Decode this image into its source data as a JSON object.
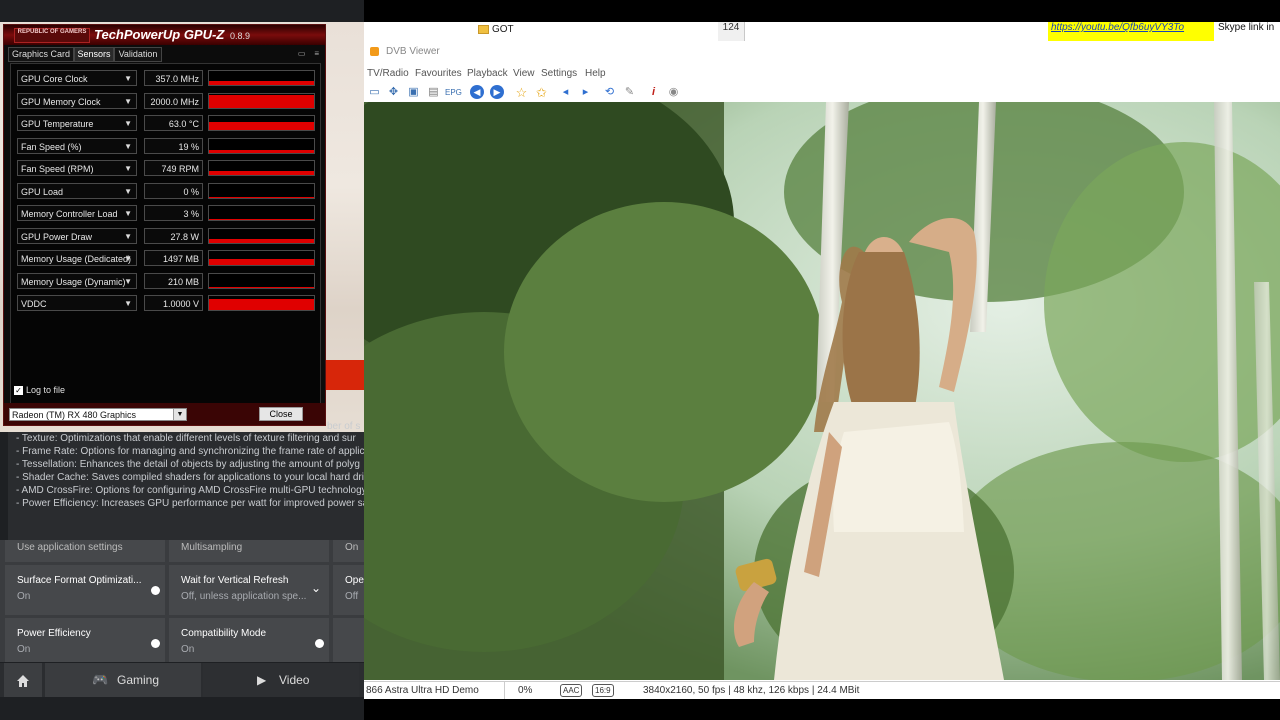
{
  "spreadsheet": {
    "folder_name": "GOT",
    "row_number": "124",
    "link": "https://youtu.be/Qfb6uyVY3To",
    "note": "Skype link in"
  },
  "radeon": {
    "description_lines": [
      "- Texture: Optimizations that enable different levels of texture filtering and sur",
      "- Frame Rate: Options for managing and synchronizing the frame rate of applic",
      "- Tessellation: Enhances the detail of objects by adjusting the amount of polyg",
      "- Shader Cache: Saves compiled shaders for applications to your local hard driv",
      "- AMD CrossFire: Options for configuring AMD CrossFire multi-GPU technology.",
      "- Power Efficiency: Increases GPU performance per watt for improved power sa"
    ],
    "partial_text": "ber of s",
    "tiles": [
      {
        "title": "Use application settings",
        "sub": ""
      },
      {
        "title": "Multisampling",
        "sub": ""
      },
      {
        "title": "On",
        "sub": ""
      },
      {
        "title": "Surface Format Optimizati...",
        "sub": "On"
      },
      {
        "title": "Wait for Vertical Refresh",
        "sub": "Off, unless application spe..."
      },
      {
        "title": "Ope",
        "sub": "Off"
      },
      {
        "title": "Power Efficiency",
        "sub": "On"
      },
      {
        "title": "Compatibility Mode",
        "sub": "On"
      }
    ],
    "nav": {
      "home": "home",
      "gaming": "Gaming",
      "video": "Video"
    }
  },
  "gpuz": {
    "logo_text": "REPUBLIC OF GAMERS",
    "title": "TechPowerUp GPU-Z",
    "version": "0.8.9",
    "tabs": [
      "Graphics Card",
      "Sensors",
      "Validation"
    ],
    "active_tab": "Sensors",
    "sensors": [
      {
        "name": "GPU Core Clock",
        "value": "357.0 MHz",
        "level": 0.25
      },
      {
        "name": "GPU Memory Clock",
        "value": "2000.0 MHz",
        "level": 0.9
      },
      {
        "name": "GPU Temperature",
        "value": "63.0 °C",
        "level": 0.55
      },
      {
        "name": "Fan Speed (%)",
        "value": "19 %",
        "level": 0.2
      },
      {
        "name": "Fan Speed (RPM)",
        "value": "749 RPM",
        "level": 0.25
      },
      {
        "name": "GPU Load",
        "value": "0 %",
        "level": 0.05
      },
      {
        "name": "Memory Controller Load",
        "value": "3 %",
        "level": 0.1
      },
      {
        "name": "GPU Power Draw",
        "value": "27.8 W",
        "level": 0.3
      },
      {
        "name": "Memory Usage (Dedicated)",
        "value": "1497 MB",
        "level": 0.4
      },
      {
        "name": "Memory Usage (Dynamic)",
        "value": "210 MB",
        "level": 0.08
      },
      {
        "name": "VDDC",
        "value": "1.0000 V",
        "level": 0.75
      }
    ],
    "log_to_file_label": "Log to file",
    "log_to_file_checked": true,
    "gpu_select": "Radeon (TM) RX 480 Graphics",
    "close_label": "Close",
    "accent": "#e00000"
  },
  "dvb": {
    "title": "DVB Viewer",
    "menu": [
      "TV/Radio",
      "Favourites",
      "Playback",
      "View",
      "Settings",
      "Help"
    ],
    "toolbar_icons": [
      "window-icon",
      "fullscreen-icon",
      "desktop-icon",
      "osd-icon",
      "epg-icon",
      "back-icon",
      "forward-icon",
      "favourite-icon",
      "favourite-add-icon",
      "volume-down-icon",
      "volume-up-icon",
      "refresh-icon",
      "tools-icon",
      "info-icon",
      "record-icon"
    ],
    "status": {
      "channel": "866 Astra Ultra HD Demo",
      "percent": "0%",
      "audio_badge": "AAC",
      "aspect_badge": "16:9",
      "stream_info": "3840x2160, 50 fps | 48 khz, 126 kbps | 24.4 MBit"
    }
  }
}
